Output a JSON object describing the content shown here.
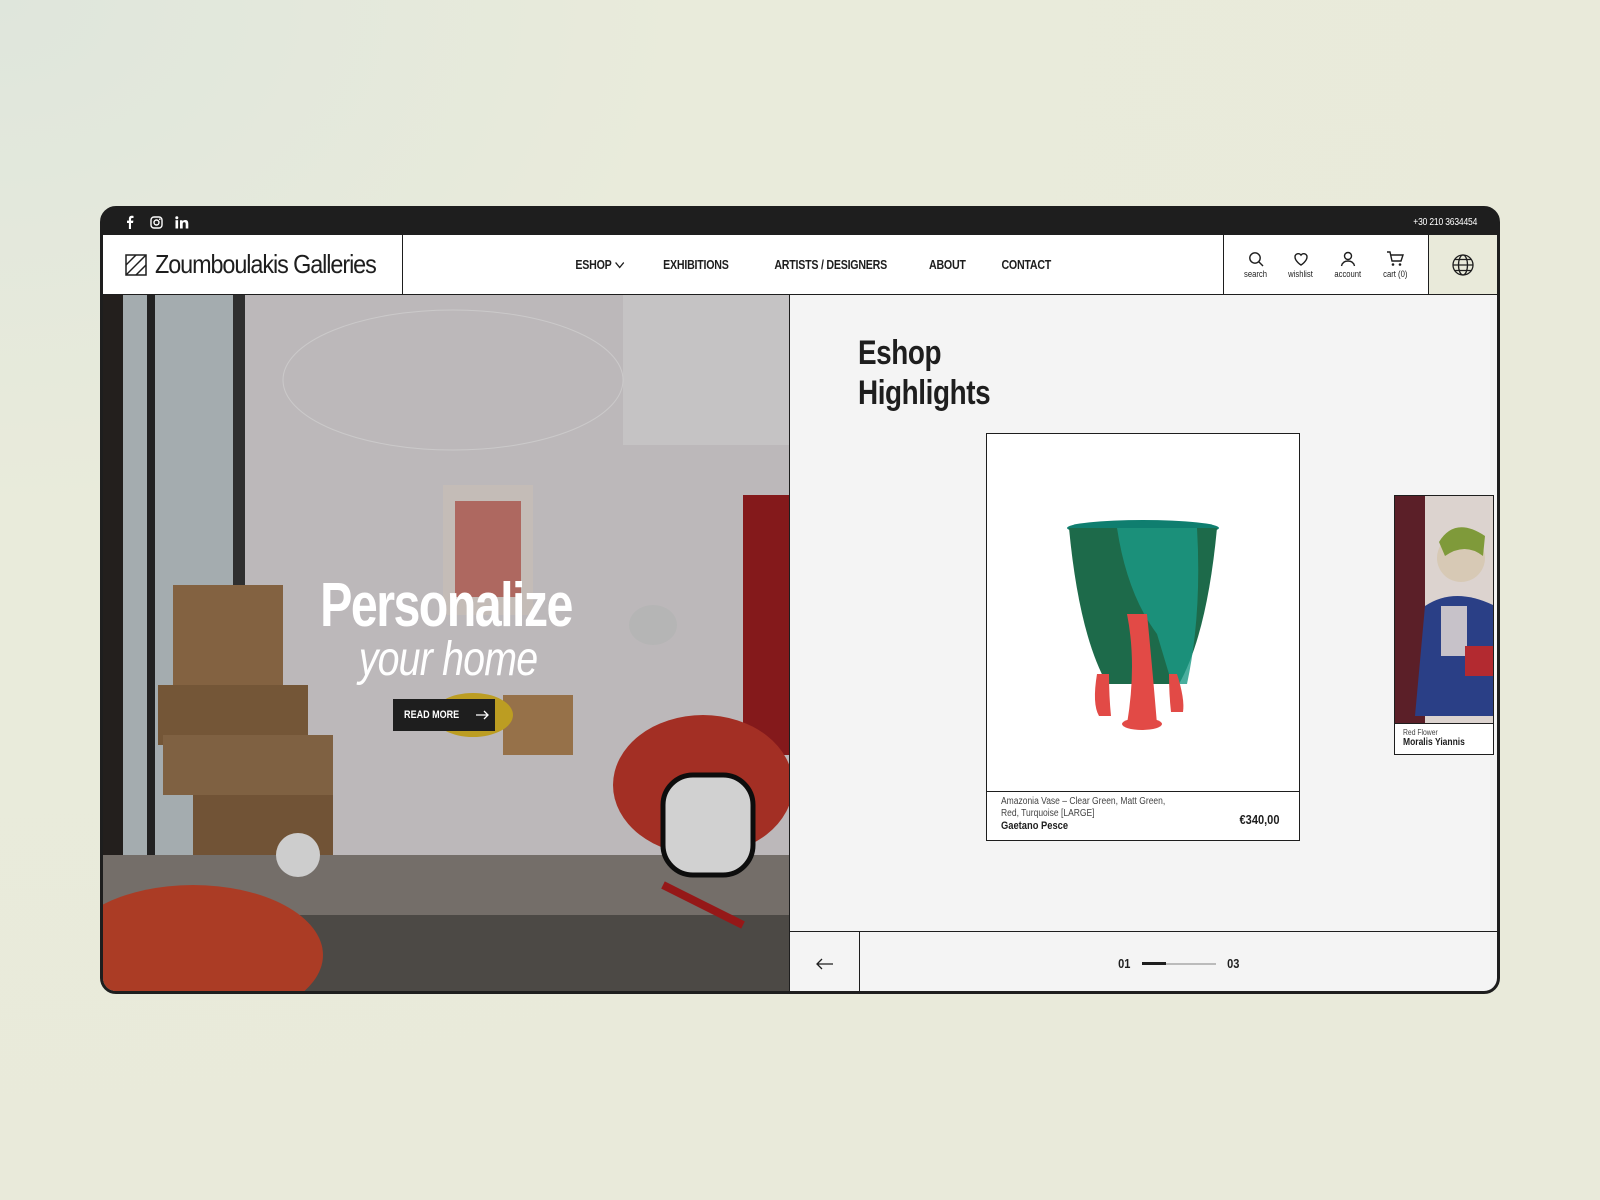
{
  "topbar": {
    "social": [
      "facebook-icon",
      "instagram-icon",
      "linkedin-icon"
    ],
    "phone": "+30 210 3634454"
  },
  "header": {
    "logo_text": "Zoumboulakis Galleries",
    "nav": [
      "ESHOP",
      "EXHIBITIONS",
      "ARTISTS / DESIGNERS",
      "ABOUT",
      "CONTACT"
    ],
    "tools": {
      "search": "search",
      "wishlist": "wishlist",
      "account": "account",
      "cart": "cart (0)"
    }
  },
  "hero": {
    "title": "Personalize",
    "subtitle": "your home",
    "button": "READ MORE"
  },
  "highlights": {
    "title_line1": "Eshop",
    "title_line2": "Highlights",
    "products": [
      {
        "description": "Amazonia Vase – Clear Green, Matt Green, Red, Turquoise [LARGE]",
        "artist": "Gaetano Pesce",
        "price": "€340,00"
      },
      {
        "description": "Red Flower",
        "artist": "Moralis Yiannis"
      }
    ]
  },
  "pager": {
    "current": "01",
    "total": "03",
    "progress_fraction": 0.33
  },
  "colors": {
    "dark": "#1e1e1e",
    "background": "#e9eada",
    "panel": "#f4f4f4"
  }
}
